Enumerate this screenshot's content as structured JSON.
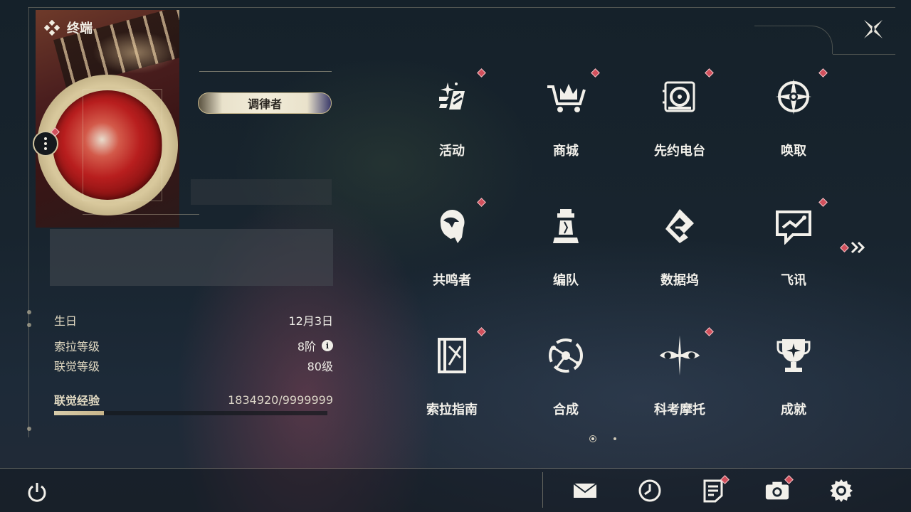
{
  "window": {
    "title": "终端"
  },
  "profile": {
    "title_badge": "调律者",
    "stats": [
      {
        "label": "生日",
        "value": "12月3日"
      },
      {
        "label": "索拉等级",
        "value": "8阶",
        "info_icon": "info-icon"
      },
      {
        "label": "联觉等级",
        "value": "80级"
      }
    ],
    "experience": {
      "label": "联觉经验",
      "value": "1834920/9999999",
      "current": 1834920,
      "max": 9999999
    }
  },
  "menu": {
    "items": [
      {
        "label": "活动",
        "icon": "events-icon",
        "badge": true
      },
      {
        "label": "商城",
        "icon": "shop-cart-icon",
        "badge": true
      },
      {
        "label": "先约电台",
        "icon": "radio-icon",
        "badge": true
      },
      {
        "label": "唤取",
        "icon": "convene-star-icon",
        "badge": true
      },
      {
        "label": "共鸣者",
        "icon": "resonator-portrait-icon",
        "badge": true
      },
      {
        "label": "编队",
        "icon": "team-chess-icon",
        "badge": false
      },
      {
        "label": "数据坞",
        "icon": "databank-icon",
        "badge": false
      },
      {
        "label": "飞讯",
        "icon": "message-icon",
        "badge": true
      },
      {
        "label": "索拉指南",
        "icon": "guidebook-icon",
        "badge": true
      },
      {
        "label": "合成",
        "icon": "synthesis-icon",
        "badge": false
      },
      {
        "label": "科考摩托",
        "icon": "motorcycle-icon",
        "badge": true
      },
      {
        "label": "成就",
        "icon": "trophy-icon",
        "badge": false
      }
    ],
    "page_current": 1,
    "page_count": 2
  },
  "bottom_bar": {
    "icons": [
      {
        "name": "mail-icon",
        "badge": false
      },
      {
        "name": "clock-icon",
        "badge": false
      },
      {
        "name": "notice-icon",
        "badge": true
      },
      {
        "name": "camera-icon",
        "badge": true
      },
      {
        "name": "settings-gear-icon",
        "badge": false
      }
    ]
  },
  "colors": {
    "accent_gold": "#d8ccaa",
    "badge_red": "#d2505c",
    "text": "#f2f0ea"
  }
}
